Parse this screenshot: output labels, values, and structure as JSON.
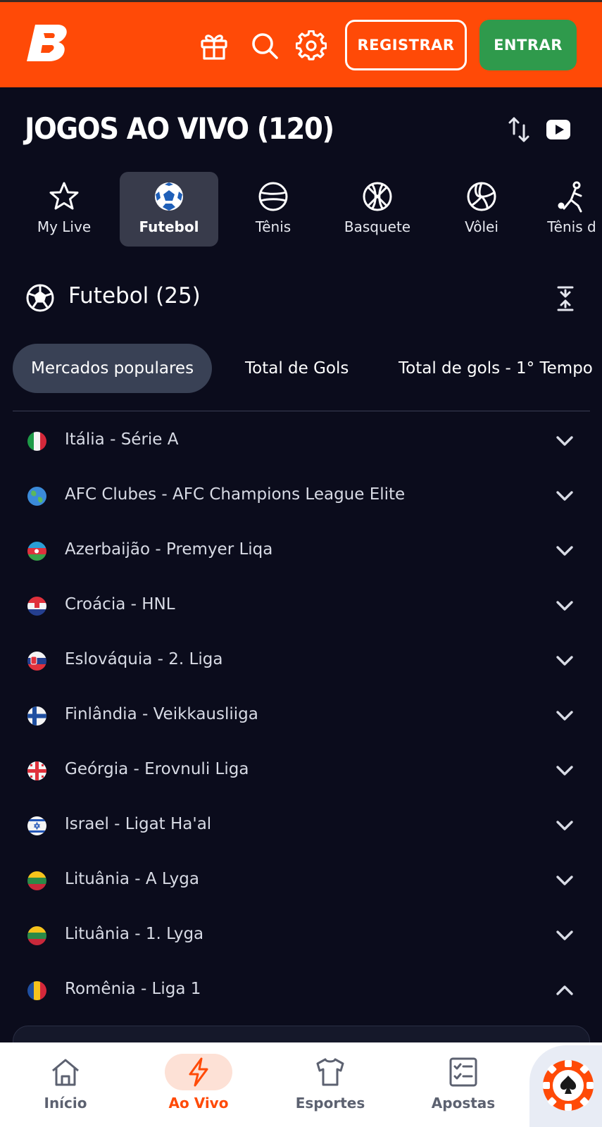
{
  "header": {
    "logo_name": "betano-logo",
    "register_label": "REGISTRAR",
    "login_label": "ENTRAR",
    "icons": [
      "gift-icon",
      "search-icon",
      "gear-icon"
    ],
    "brand_color": "#ff4a07",
    "login_color": "#2f9a4c"
  },
  "page": {
    "title": "JOGOS AO VIVO  (120)",
    "actions": [
      "sort-icon",
      "video-icon"
    ]
  },
  "sport_tabs": [
    {
      "label": "My Live",
      "icon": "star-icon"
    },
    {
      "label": "Futebol",
      "icon": "soccer-ball-icon",
      "active": true
    },
    {
      "label": "Tênis",
      "icon": "tennis-ball-icon"
    },
    {
      "label": "Basquete",
      "icon": "basketball-icon"
    },
    {
      "label": "Vôlei",
      "icon": "volleyball-icon"
    },
    {
      "label": "Tênis d",
      "icon": "table-tennis-icon"
    }
  ],
  "section": {
    "title": "Futebol (25)",
    "icon": "soccer-ball-icon"
  },
  "market_tabs": [
    {
      "label": "Mercados populares",
      "active": true
    },
    {
      "label": "Total de Gols"
    },
    {
      "label": "Total de gols - 1° Tempo"
    }
  ],
  "leagues": [
    {
      "name": "Itália - Série A",
      "flag": "italy",
      "expanded": false
    },
    {
      "name": "AFC Clubes - AFC Champions League Elite",
      "flag": "globe",
      "expanded": false
    },
    {
      "name": "Azerbaijão - Premyer Liqa",
      "flag": "azerbaijan",
      "expanded": false
    },
    {
      "name": "Croácia - HNL",
      "flag": "croatia",
      "expanded": false
    },
    {
      "name": "Eslováquia - 2. Liga",
      "flag": "slovakia",
      "expanded": false
    },
    {
      "name": "Finlândia - Veikkausliiga",
      "flag": "finland",
      "expanded": false
    },
    {
      "name": "Geórgia - Erovnuli Liga",
      "flag": "georgia",
      "expanded": false
    },
    {
      "name": "Israel - Ligat Ha'al",
      "flag": "israel",
      "expanded": false
    },
    {
      "name": "Lituânia - A Lyga",
      "flag": "lithuania",
      "expanded": false
    },
    {
      "name": "Lituânia - 1. Lyga",
      "flag": "lithuania",
      "expanded": false
    },
    {
      "name": "Romênia - Liga 1",
      "flag": "romania",
      "expanded": true
    }
  ],
  "bottom_nav": [
    {
      "label": "Início",
      "icon": "home-icon"
    },
    {
      "label": "Ao Vivo",
      "icon": "lightning-icon",
      "active": true
    },
    {
      "label": "Esportes",
      "icon": "jersey-icon"
    },
    {
      "label": "Apostas",
      "icon": "betslip-icon"
    }
  ],
  "casino_icon": "poker-chip-icon"
}
